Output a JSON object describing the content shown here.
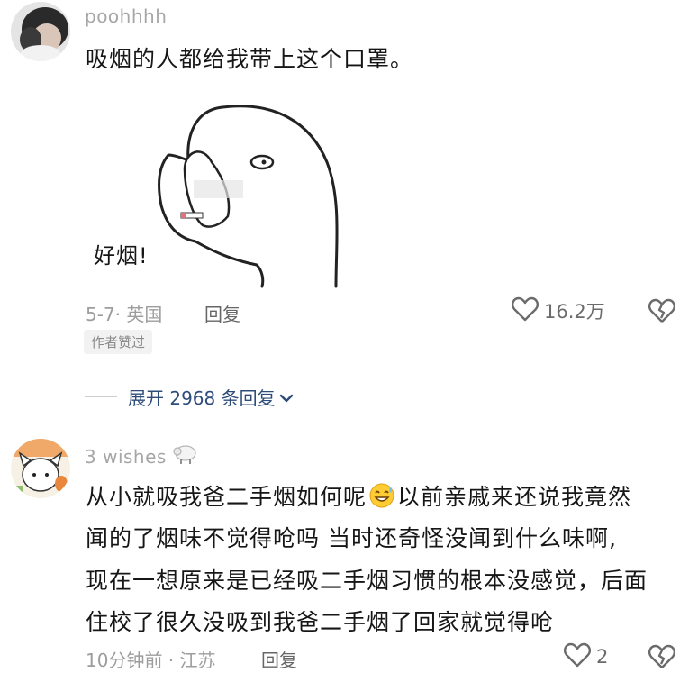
{
  "comment1": {
    "username": "poohhhh",
    "text": "吸烟的人都给我带上这个口罩。",
    "image_caption": "好烟!",
    "meta": "5-7· 英国",
    "reply_label": "回复",
    "likes": "16.2万",
    "author_badge": "作者赞过"
  },
  "expand": {
    "label": "展开 2968 条回复"
  },
  "comment2": {
    "username": "3 wishes",
    "lines": {
      "l1a": "从小就吸我爸二手烟如何呢",
      "l1b": "以前亲戚来还说我竟然",
      "l2": "闻的了烟味不觉得呛吗 当时还奇怪没闻到什么味啊,",
      "l3": "现在一想原来是已经吸二手烟习惯的根本没感觉，后面",
      "l4": "住校了很久没吸到我爸二手烟了回家就觉得呛"
    },
    "meta": "10分钟前 · 江苏",
    "reply_label": "回复",
    "likes": "2"
  },
  "icons": {
    "like": "heart-outline-icon",
    "dislike": "broken-heart-icon",
    "expand_chevron": "chevron-down-icon",
    "sheep": "sheep-icon",
    "emoji": "grinning-sweat-emoji-icon"
  },
  "colors": {
    "link": "#2e4c7a",
    "meta": "#9d9d9d",
    "text": "#161616"
  }
}
